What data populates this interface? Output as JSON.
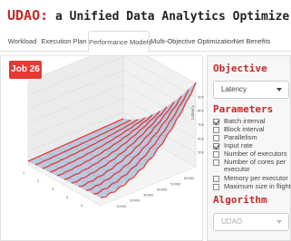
{
  "app": {
    "brand": "UDAO:",
    "title_rest": " a Unified Data Analytics Optimizer"
  },
  "tabs": [
    {
      "label": "Workload",
      "active": false
    },
    {
      "label": "Execution Plan",
      "active": false
    },
    {
      "label": "Performance Models",
      "active": true
    },
    {
      "label": "Multi-Objective Optimization",
      "active": false
    },
    {
      "label": "Net Benefits",
      "active": false
    }
  ],
  "plot": {
    "job_label": "Job 26",
    "z_axis_label": "Latency",
    "x_ticks": [
      "1",
      "2",
      "3",
      "4",
      "5"
    ],
    "y_ticks": [
      "10000",
      "20000",
      "30000",
      "40000",
      "50000",
      "60000"
    ],
    "z_ticks": [
      "5000",
      "6000",
      "7000",
      "8000",
      "9000"
    ],
    "colors": {
      "surface": "#b9c9df",
      "wire": "#e53935",
      "edge": "#6d7f99"
    }
  },
  "sidebar": {
    "objective_title": "Objective",
    "objective_value": "Latency",
    "parameters_title": "Parameters",
    "parameters": [
      {
        "label": "Batch interval",
        "checked": true
      },
      {
        "label": "Block interval",
        "checked": false
      },
      {
        "label": "Parallelism",
        "checked": false
      },
      {
        "label": "Input rate",
        "checked": true
      },
      {
        "label": "Number of executors",
        "checked": false
      },
      {
        "label": "Number of cores per executor",
        "checked": false
      },
      {
        "label": "Memory per executor",
        "checked": false
      },
      {
        "label": "Maximum size in flight",
        "checked": false
      }
    ],
    "algorithm_title": "Algorithm",
    "algorithm_value": "UDAO"
  }
}
